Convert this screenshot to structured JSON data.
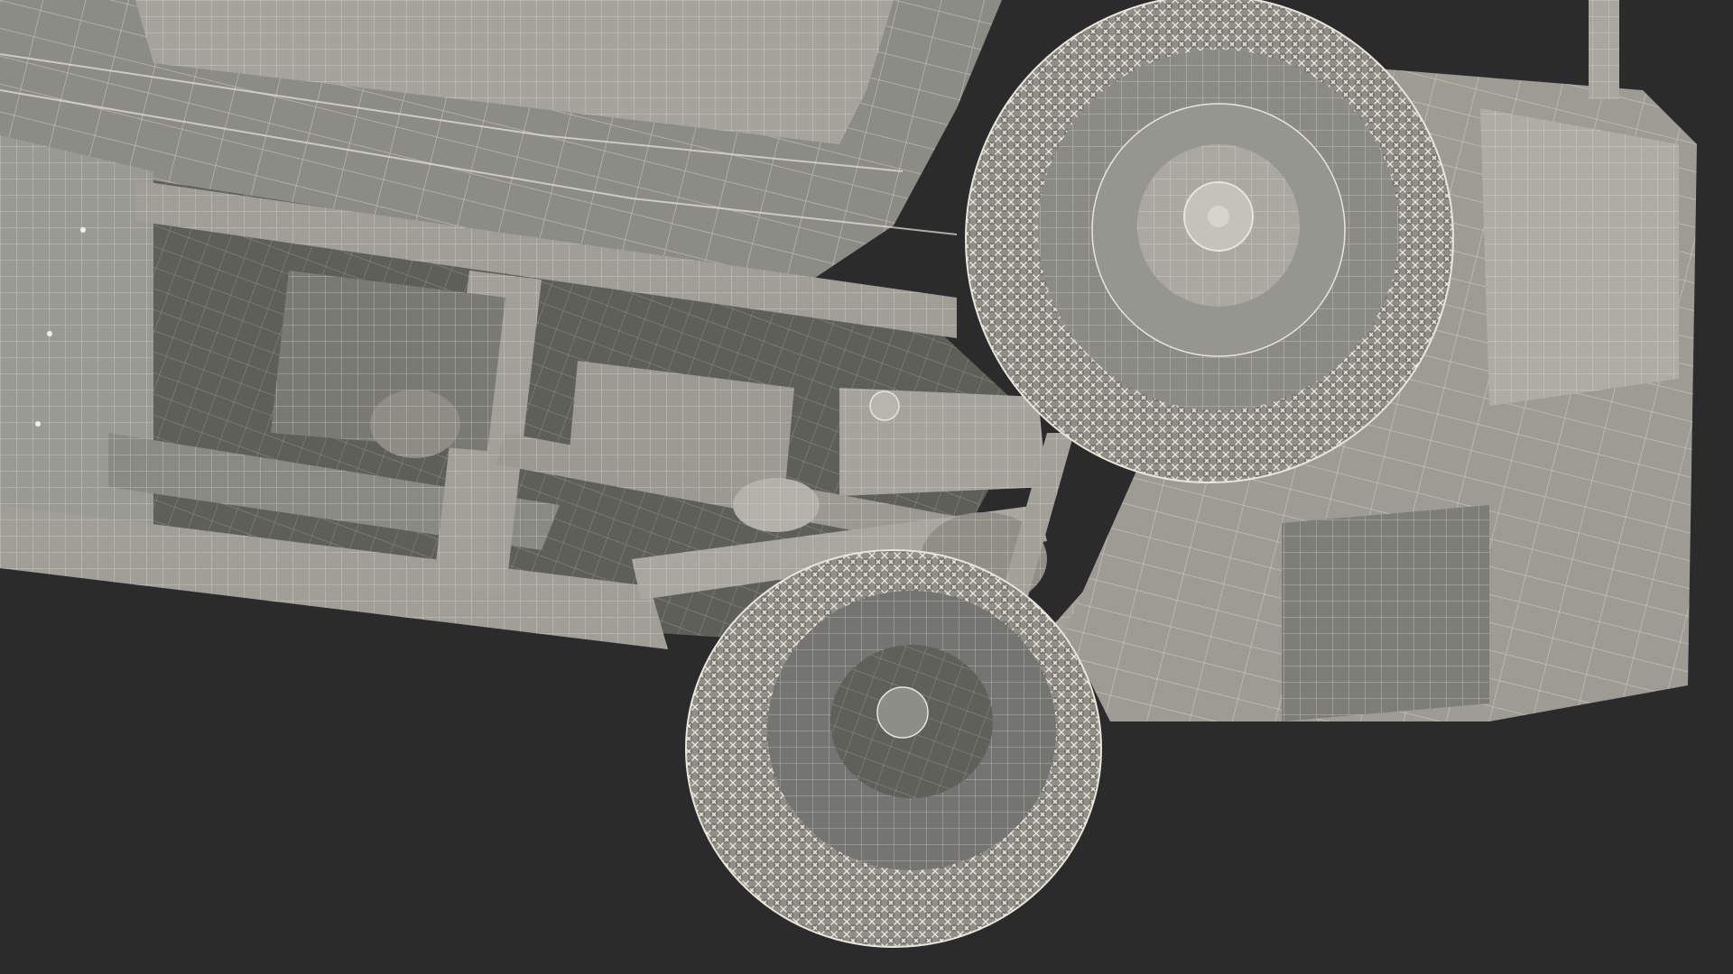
{
  "scene": {
    "background_color": "#2b2b2b",
    "model_fill_color": "#8c8c86",
    "model_light_color": "#a9a9a3",
    "model_dark_color": "#5e5e59",
    "wire_color": "#e7e6dc",
    "wire_dark_color": "#45453f"
  }
}
